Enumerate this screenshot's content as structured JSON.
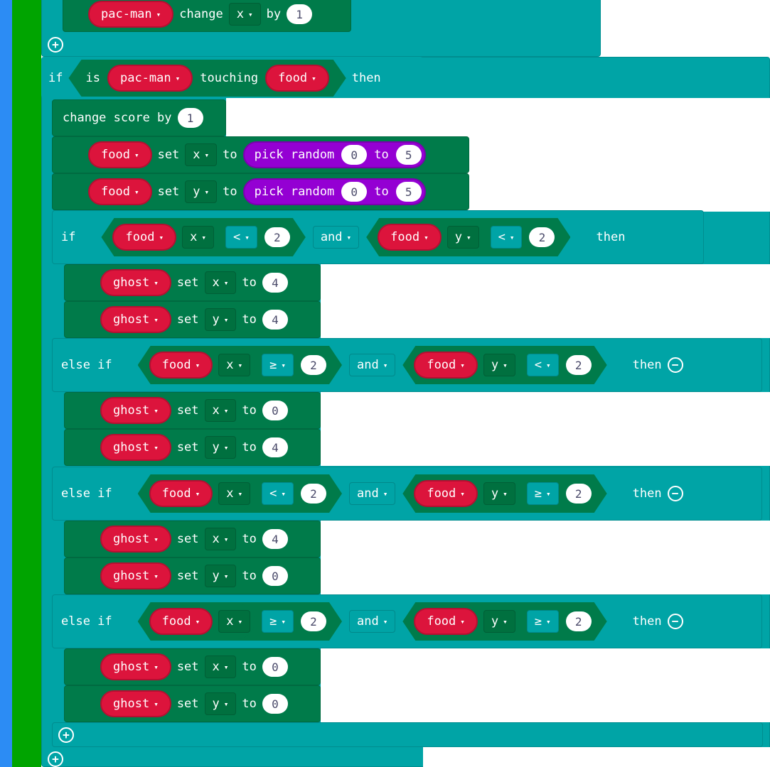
{
  "top_block": {
    "sprite": "pac-man",
    "verb": "change",
    "prop": "x",
    "by_label": "by",
    "value": "1"
  },
  "if_block": {
    "if_label": "if",
    "is_label": "is",
    "sprite": "pac-man",
    "touching_label": "touching",
    "target": "food",
    "then_label": "then"
  },
  "change_score": {
    "label": "change score by",
    "value": "1"
  },
  "food_x": {
    "sprite": "food",
    "set_label": "set",
    "prop": "x",
    "to_label": "to",
    "random_label": "pick random",
    "from": "0",
    "to_word": "to",
    "to": "5"
  },
  "food_y": {
    "sprite": "food",
    "set_label": "set",
    "prop": "y",
    "to_label": "to",
    "random_label": "pick random",
    "from": "0",
    "to_word": "to",
    "to": "5"
  },
  "branches": [
    {
      "label": "if",
      "a_sprite": "food",
      "a_prop": "x",
      "a_op": "<",
      "a_val": "2",
      "logic": "and",
      "b_sprite": "food",
      "b_prop": "y",
      "b_op": "<",
      "b_val": "2",
      "then": "then",
      "stmts": [
        {
          "sprite": "ghost",
          "set": "set",
          "prop": "x",
          "to": "to",
          "val": "4"
        },
        {
          "sprite": "ghost",
          "set": "set",
          "prop": "y",
          "to": "to",
          "val": "4"
        }
      ]
    },
    {
      "label": "else if",
      "a_sprite": "food",
      "a_prop": "x",
      "a_op": "≥",
      "a_val": "2",
      "logic": "and",
      "b_sprite": "food",
      "b_prop": "y",
      "b_op": "<",
      "b_val": "2",
      "then": "then",
      "stmts": [
        {
          "sprite": "ghost",
          "set": "set",
          "prop": "x",
          "to": "to",
          "val": "0"
        },
        {
          "sprite": "ghost",
          "set": "set",
          "prop": "y",
          "to": "to",
          "val": "4"
        }
      ]
    },
    {
      "label": "else if",
      "a_sprite": "food",
      "a_prop": "x",
      "a_op": "<",
      "a_val": "2",
      "logic": "and",
      "b_sprite": "food",
      "b_prop": "y",
      "b_op": "≥",
      "b_val": "2",
      "then": "then",
      "stmts": [
        {
          "sprite": "ghost",
          "set": "set",
          "prop": "x",
          "to": "to",
          "val": "4"
        },
        {
          "sprite": "ghost",
          "set": "set",
          "prop": "y",
          "to": "to",
          "val": "0"
        }
      ]
    },
    {
      "label": "else if",
      "a_sprite": "food",
      "a_prop": "x",
      "a_op": "≥",
      "a_val": "2",
      "logic": "and",
      "b_sprite": "food",
      "b_prop": "y",
      "b_op": "≥",
      "b_val": "2",
      "then": "then",
      "stmts": [
        {
          "sprite": "ghost",
          "set": "set",
          "prop": "x",
          "to": "to",
          "val": "0"
        },
        {
          "sprite": "ghost",
          "set": "set",
          "prop": "y",
          "to": "to",
          "val": "0"
        }
      ]
    }
  ],
  "icons": {
    "plus": "+",
    "minus": "−",
    "caret": "▾"
  }
}
